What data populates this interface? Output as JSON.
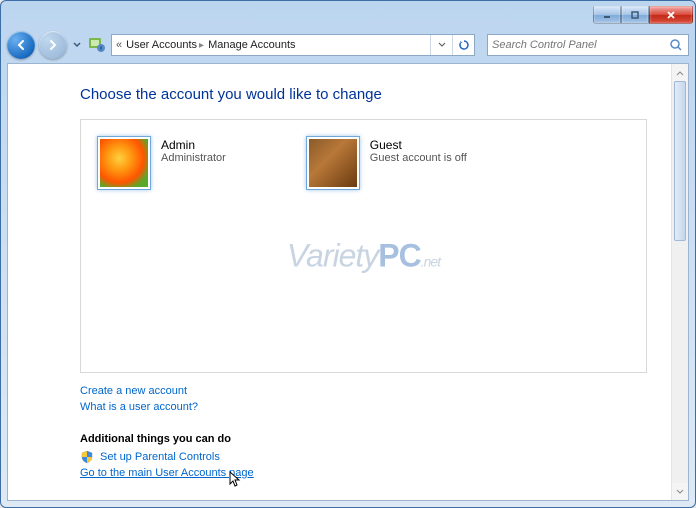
{
  "breadcrumb": {
    "item1": "User Accounts",
    "item2": "Manage Accounts"
  },
  "search": {
    "placeholder": "Search Control Panel"
  },
  "page": {
    "heading": "Choose the account you would like to change"
  },
  "accounts": [
    {
      "name": "Admin",
      "subtitle": "Administrator"
    },
    {
      "name": "Guest",
      "subtitle": "Guest account is off"
    }
  ],
  "links": {
    "create": "Create a new account",
    "what": "What is a user account?"
  },
  "additional": {
    "heading": "Additional things you can do",
    "parental": "Set up Parental Controls",
    "mainpage": "Go to the main User Accounts page"
  },
  "watermark": {
    "part1": "Variety",
    "part2": "PC",
    "part3": ".net"
  }
}
